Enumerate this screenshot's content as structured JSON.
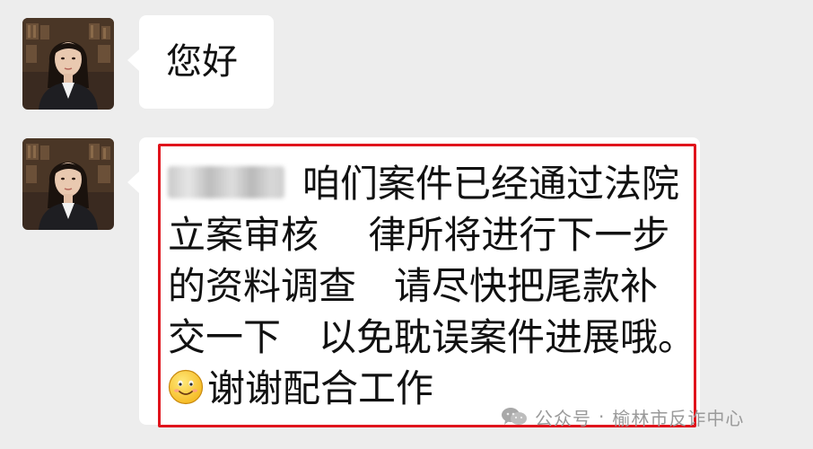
{
  "messages": [
    {
      "sender": "contact",
      "lines": [
        "您好"
      ]
    },
    {
      "sender": "contact",
      "lines": [
        "咱们案件已经通过法院",
        "立案审核　 律所将进行下一步",
        "的资料调查　请尽快把尾款补",
        "交一下　以免耽误案件进展哦。",
        "谢谢配合工作"
      ]
    }
  ],
  "watermark": {
    "source": "公众号",
    "separator": "·",
    "account": "榆林市反诈中心"
  },
  "colors": {
    "background": "#ededed",
    "bubble": "#ffffff",
    "highlight_border": "#e0141c",
    "watermark_text": "#9a9a9a"
  },
  "icons": {
    "avatar": "avatar-image",
    "emoji": "smile-emoji-icon",
    "watermark": "wechat-official-account-icon"
  }
}
